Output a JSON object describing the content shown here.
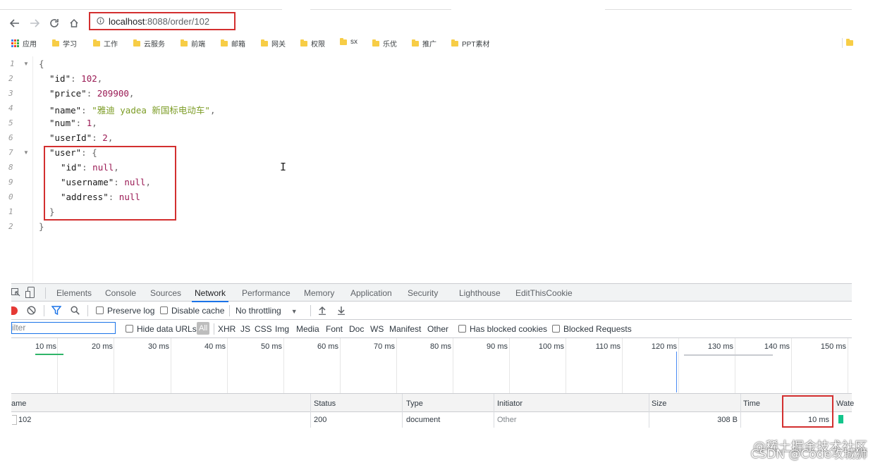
{
  "browser": {
    "url_host": "localhost",
    "url_path": ":8088/order/102"
  },
  "bookmarks": {
    "apps_label": "应用",
    "folders": [
      "学习",
      "工作",
      "云服务",
      "前端",
      "邮箱",
      "网关",
      "权限",
      "sx",
      "乐优",
      "推广",
      "PPT素材"
    ]
  },
  "json_view": {
    "line_numbers": [
      "1",
      "2",
      "3",
      "4",
      "5",
      "6",
      "7",
      "8",
      "9",
      "0",
      "1",
      "2"
    ],
    "open_brace": "{",
    "close_brace": "}",
    "fields": {
      "id_key": "\"id\"",
      "id_val": "102",
      "price_key": "\"price\"",
      "price_val": "209900",
      "name_key": "\"name\"",
      "name_val": "\"雅迪 yadea 新国标电动车\"",
      "num_key": "\"num\"",
      "num_val": "1",
      "userId_key": "\"userId\"",
      "userId_val": "2",
      "user_key": "\"user\"",
      "user_id_key": "\"id\"",
      "user_id_val": "null",
      "username_key": "\"username\"",
      "username_val": "null",
      "address_key": "\"address\"",
      "address_val": "null"
    }
  },
  "devtools": {
    "tabs": [
      "Elements",
      "Console",
      "Sources",
      "Network",
      "Performance",
      "Memory",
      "Application",
      "Security",
      "Lighthouse",
      "EditThisCookie"
    ],
    "active_tab": "Network",
    "toolbar": {
      "preserve_log": "Preserve log",
      "disable_cache": "Disable cache",
      "throttling": "No throttling"
    },
    "filter": {
      "placeholder": "ilter",
      "hide_data_urls": "Hide data URLs",
      "all": "All",
      "types": [
        "XHR",
        "JS",
        "CSS",
        "Img",
        "Media",
        "Font",
        "Doc",
        "WS",
        "Manifest",
        "Other"
      ],
      "has_blocked_cookies": "Has blocked cookies",
      "blocked_requests": "Blocked Requests"
    },
    "timeline_ticks": [
      "10 ms",
      "20 ms",
      "30 ms",
      "40 ms",
      "50 ms",
      "60 ms",
      "70 ms",
      "80 ms",
      "90 ms",
      "100 ms",
      "110 ms",
      "120 ms",
      "130 ms",
      "140 ms",
      "150 ms"
    ],
    "table": {
      "headers": {
        "name": "ame",
        "status": "Status",
        "type": "Type",
        "initiator": "Initiator",
        "size": "Size",
        "time": "Time",
        "waterfall": "Wate"
      },
      "rows": [
        {
          "name": "102",
          "status": "200",
          "type": "document",
          "initiator": "Other",
          "size": "308 B",
          "time": "10 ms"
        }
      ]
    }
  },
  "watermark": {
    "line1": "@稀土掘金技术社区",
    "line2": "CSDN @Code攻城狮"
  },
  "colors": {
    "highlight_box": "#d32f2f",
    "json_number": "#9a1a54",
    "json_string": "#7c9c25",
    "active_tab_underline": "#1a73e8",
    "waterfall_bar": "#13c58b"
  }
}
